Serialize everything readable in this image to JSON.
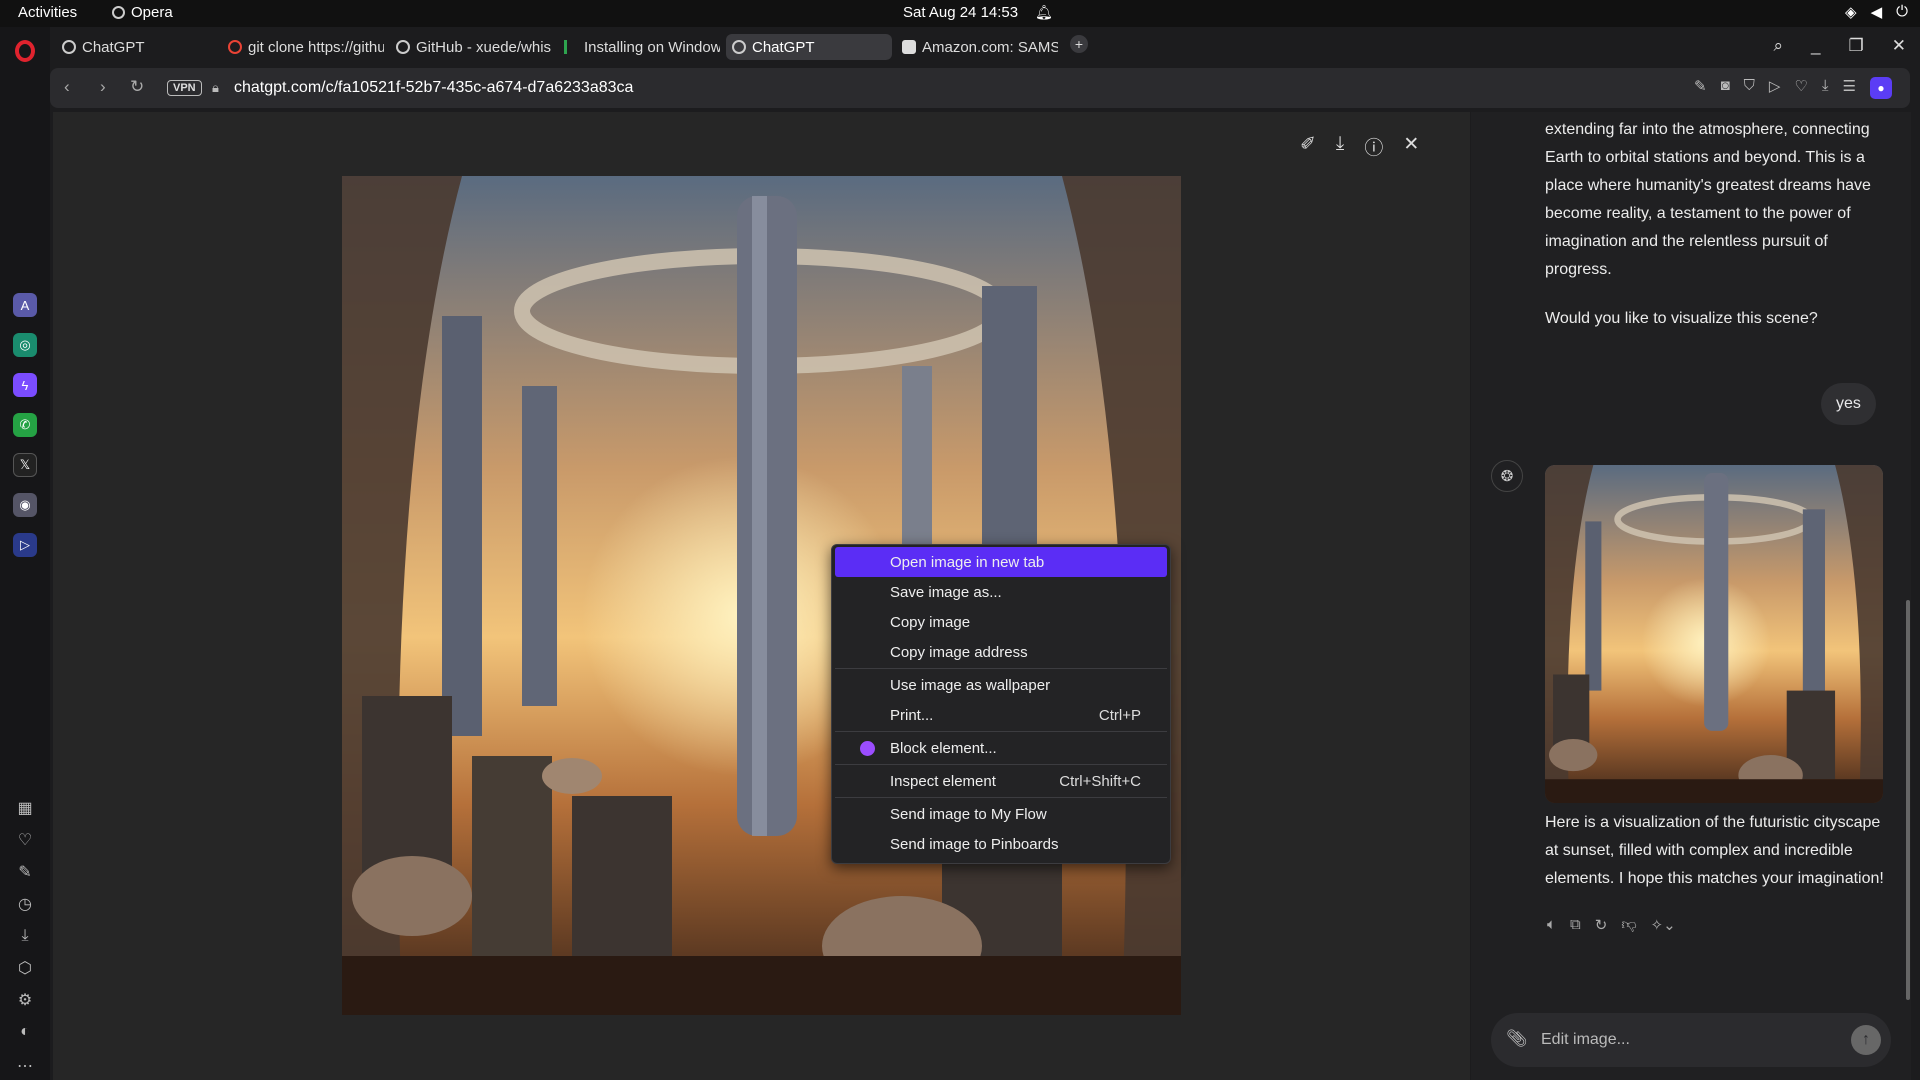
{
  "system": {
    "activities": "Activities",
    "app_name": "Opera",
    "clock": "Sat Aug 24  14:53"
  },
  "tabs": [
    {
      "label": "ChatGPT",
      "active": false
    },
    {
      "label": "git clone https://githu",
      "active": false
    },
    {
      "label": "GitHub - xuede/whisp",
      "active": false
    },
    {
      "label": "Installing on Windows",
      "active": false
    },
    {
      "label": "ChatGPT",
      "active": true
    },
    {
      "label": "Amazon.com: SAMS",
      "active": false
    }
  ],
  "addressbar": {
    "vpn": "VPN",
    "url": "chatgpt.com/c/fa10521f-52b7-435c-a674-d7a6233a83ca"
  },
  "context_menu": {
    "items": [
      {
        "label": "Open image in new tab",
        "shortcut": ""
      },
      {
        "label": "Save image as...",
        "shortcut": ""
      },
      {
        "label": "Copy image",
        "shortcut": ""
      },
      {
        "label": "Copy image address",
        "shortcut": ""
      },
      {
        "label": "Use image as wallpaper",
        "shortcut": ""
      },
      {
        "label": "Print...",
        "shortcut": "Ctrl+P"
      },
      {
        "label": "Block element...",
        "shortcut": ""
      },
      {
        "label": "Inspect element",
        "shortcut": "Ctrl+Shift+C"
      },
      {
        "label": "Send image to My Flow",
        "shortcut": ""
      },
      {
        "label": "Send image to Pinboards",
        "shortcut": ""
      }
    ]
  },
  "chat": {
    "assistant_text_1": "extending far into the atmosphere, connecting Earth to orbital stations and beyond. This is a place where humanity's greatest dreams have become reality, a testament to the power of imagination and the relentless pursuit of progress.",
    "assistant_text_2": "Would you like to visualize this scene?",
    "user_message": "yes",
    "assistant_text_3": "Here is a visualization of the futuristic cityscape at sunset, filled with complex and incredible elements. I hope this matches your imagination!",
    "composer_placeholder": "Edit image..."
  },
  "colors": {
    "accent": "#5b2df5",
    "opera_red": "#e0232e"
  }
}
